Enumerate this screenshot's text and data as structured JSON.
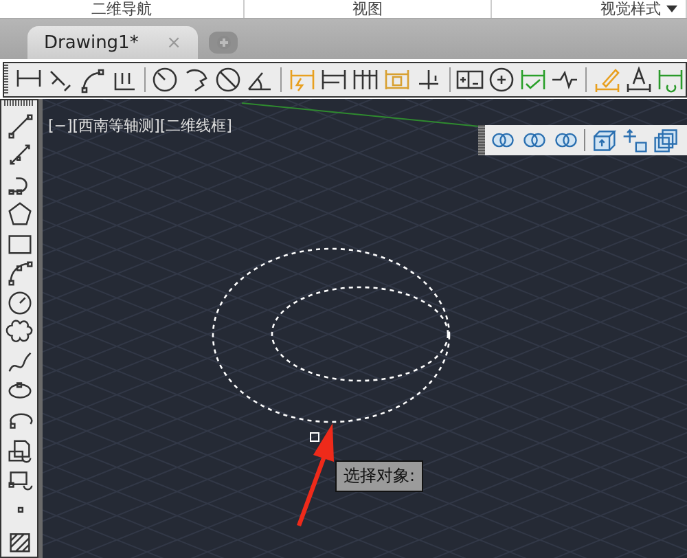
{
  "ribbon_panels": [
    {
      "label": "二维导航",
      "dropdown": false
    },
    {
      "label": "视图",
      "dropdown": false
    },
    {
      "label": "视觉样式",
      "dropdown": true
    }
  ],
  "tabs": [
    {
      "label": "Drawing1*",
      "close": "×",
      "selected": true
    }
  ],
  "viewport": {
    "label": "[−][西南等轴测][二维线框]"
  },
  "tooltip": {
    "text": "选择对象:"
  }
}
